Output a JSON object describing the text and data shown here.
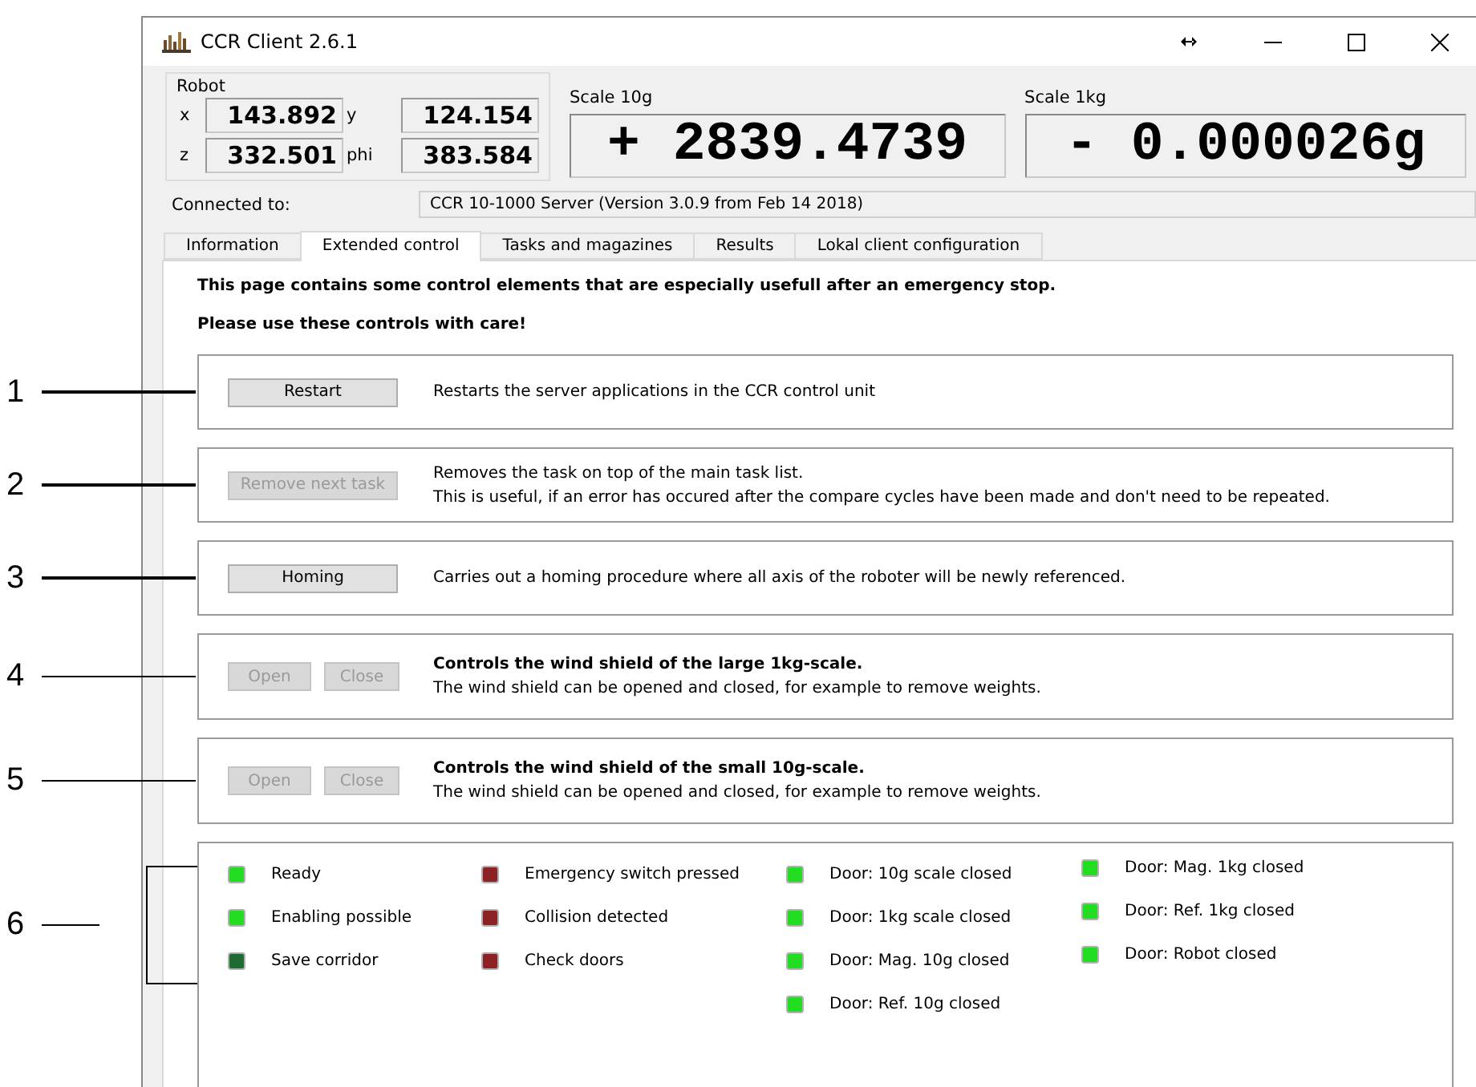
{
  "window": {
    "title": "CCR Client 2.6.1"
  },
  "robot": {
    "label": "Robot",
    "fields": [
      {
        "label": "x",
        "value": "143.892"
      },
      {
        "label": "y",
        "value": "124.154"
      },
      {
        "label": "z",
        "value": "332.501"
      },
      {
        "label": "phi",
        "value": "383.584"
      }
    ]
  },
  "scales": [
    {
      "label": "Scale 10g",
      "reading": "+ 2839.4739"
    },
    {
      "label": "Scale 1kg",
      "reading": "- 0.000026g"
    }
  ],
  "connection": {
    "label": "Connected to:",
    "value": "CCR 10-1000 Server (Version 3.0.9 from Feb 14 2018)"
  },
  "tabs": [
    {
      "label": "Information",
      "selected": false
    },
    {
      "label": "Extended control",
      "selected": true
    },
    {
      "label": "Tasks and magazines",
      "selected": false
    },
    {
      "label": "Results",
      "selected": false
    },
    {
      "label": "Lokal client configuration",
      "selected": false
    }
  ],
  "intro": [
    "This page contains some control elements that are especially usefull after an emergency stop.",
    "Please use these controls with care!"
  ],
  "controls": [
    {
      "callout": "1",
      "buttons": [
        {
          "label": "Restart",
          "disabled": false
        }
      ],
      "lines": [
        {
          "text": "Restarts the server applications in the CCR control unit",
          "bold": false
        }
      ]
    },
    {
      "callout": "2",
      "buttons": [
        {
          "label": "Remove next task",
          "disabled": true
        }
      ],
      "lines": [
        {
          "text": "Removes the task on top of the main task list.",
          "bold": false
        },
        {
          "text": "This is useful, if an error has occured after the compare cycles have been made and don't need to be repeated.",
          "bold": false
        }
      ]
    },
    {
      "callout": "3",
      "buttons": [
        {
          "label": "Homing",
          "disabled": false
        }
      ],
      "lines": [
        {
          "text": "Carries out a homing procedure where all axis of the roboter will be newly referenced.",
          "bold": false
        }
      ]
    },
    {
      "callout": "4",
      "buttons": [
        {
          "label": "Open",
          "disabled": true
        },
        {
          "label": "Close",
          "disabled": true
        }
      ],
      "lines": [
        {
          "text": "Controls the wind shield of the large 1kg-scale.",
          "bold": true
        },
        {
          "text": "The wind shield can be opened and closed, for example to remove weights.",
          "bold": false
        }
      ]
    },
    {
      "callout": "5",
      "buttons": [
        {
          "label": "Open",
          "disabled": true
        },
        {
          "label": "Close",
          "disabled": true
        }
      ],
      "lines": [
        {
          "text": "Controls the wind shield of the small 10g-scale.",
          "bold": true
        },
        {
          "text": "The wind shield can be opened and closed, for example to remove weights.",
          "bold": false
        }
      ]
    }
  ],
  "status": {
    "callout": "6",
    "columns": [
      [
        {
          "label": "Ready",
          "color": "#22dd22"
        },
        {
          "label": "Enabling possible",
          "color": "#22dd22"
        },
        {
          "label": "Save corridor",
          "color": "#1e6b34"
        }
      ],
      [
        {
          "label": "Emergency switch pressed",
          "color": "#8c2226"
        },
        {
          "label": "Collision detected",
          "color": "#8c2226"
        },
        {
          "label": "Check doors",
          "color": "#8c2226"
        }
      ],
      [
        {
          "label": "Door: 10g scale closed",
          "color": "#22dd22"
        },
        {
          "label": "Door: 1kg scale closed",
          "color": "#22dd22"
        },
        {
          "label": "Door: Mag. 10g closed",
          "color": "#22dd22"
        },
        {
          "label": "Door: Ref. 10g closed",
          "color": "#22dd22"
        }
      ],
      [
        {
          "label": "Door: Mag. 1kg closed",
          "color": "#22dd22"
        },
        {
          "label": "Door: Ref. 1kg closed",
          "color": "#22dd22"
        },
        {
          "label": "Door: Robot closed",
          "color": "#22dd22"
        }
      ]
    ]
  }
}
